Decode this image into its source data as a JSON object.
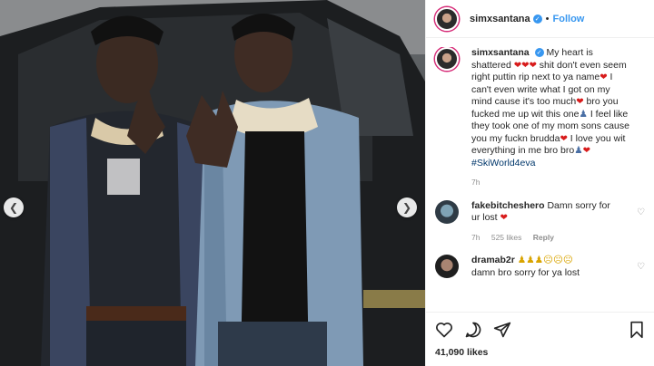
{
  "post": {
    "username": "simxsantana",
    "follow_label": "Follow",
    "dot": "•",
    "likes": "41,090 likes"
  },
  "caption": {
    "username": "simxsantana",
    "text_1": "My heart is shattered",
    "text_2": " shit don't even seem right puttin rip next to ya name",
    "text_3": " I can't even write what I got on my mind cause it's too much",
    "text_4": " bro you fucked me up wit this one",
    "text_5": " I feel like they took one of my mom sons cause you my fuckn brudda",
    "text_6": " I love you wit everything in me bro bro",
    "hashtag": "#SkiWorld4eva",
    "time": "7h"
  },
  "comments": [
    {
      "username": "fakebitcheshero",
      "text": "Damn sorry for ur lost",
      "time": "7h",
      "likes": "525 likes",
      "reply": "Reply"
    },
    {
      "username": "dramab2r",
      "text": "damn bro sorry for ya lost"
    }
  ],
  "icons": {
    "heart": "♥",
    "like": "♡",
    "prev": "❮",
    "next": "❯"
  }
}
